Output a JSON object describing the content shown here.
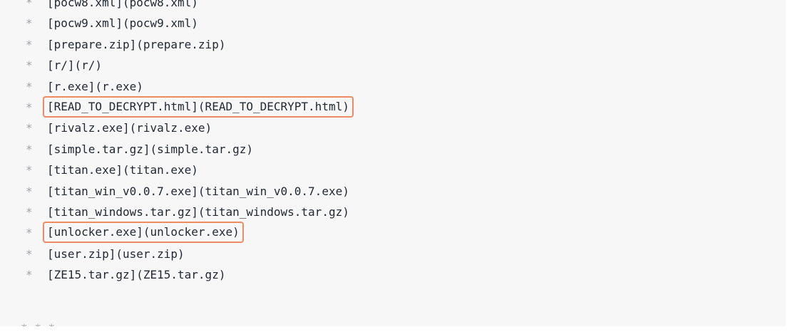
{
  "listing": {
    "bullet": "*",
    "items": [
      {
        "text": "[pocw8.xml](pocw8.xml)",
        "highlighted": false
      },
      {
        "text": "[pocw9.xml](pocw9.xml)",
        "highlighted": false
      },
      {
        "text": "[prepare.zip](prepare.zip)",
        "highlighted": false
      },
      {
        "text": "[r/](r/)",
        "highlighted": false
      },
      {
        "text": "[r.exe](r.exe)",
        "highlighted": false
      },
      {
        "text": "[READ_TO_DECRYPT.html](READ_TO_DECRYPT.html)",
        "highlighted": true
      },
      {
        "text": "[rivalz.exe](rivalz.exe)",
        "highlighted": false
      },
      {
        "text": "[simple.tar.gz](simple.tar.gz)",
        "highlighted": false
      },
      {
        "text": "[titan.exe](titan.exe)",
        "highlighted": false
      },
      {
        "text": "[titan_win_v0.0.7.exe](titan_win_v0.0.7.exe)",
        "highlighted": false
      },
      {
        "text": "[titan_windows.tar.gz](titan_windows.tar.gz)",
        "highlighted": false
      },
      {
        "text": "[unlocker.exe](unlocker.exe)",
        "highlighted": true
      },
      {
        "text": "[user.zip](user.zip)",
        "highlighted": false
      },
      {
        "text": "[ZE15.tar.gz](ZE15.tar.gz)",
        "highlighted": false
      }
    ],
    "horizontal_rule": "* * *"
  },
  "colors": {
    "background": "#f7f7f7",
    "text": "#222833",
    "bullet": "#a0a4aa",
    "highlight_box": "#ef8b63"
  }
}
